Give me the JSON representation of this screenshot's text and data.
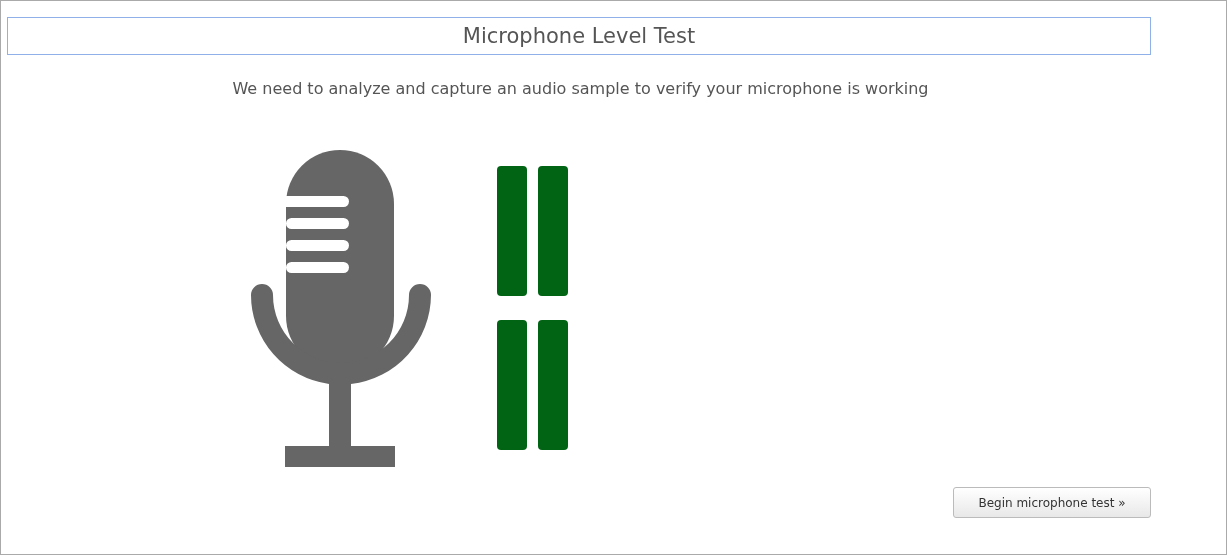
{
  "title": "Microphone Level Test",
  "description": "We need to analyze and capture an audio sample to verify your microphone is working",
  "level_meter": {
    "segments": [
      {
        "on": true
      },
      {
        "on": true
      },
      {
        "on": true
      },
      {
        "on": true
      }
    ]
  },
  "button": {
    "label": "Begin microphone test »"
  }
}
